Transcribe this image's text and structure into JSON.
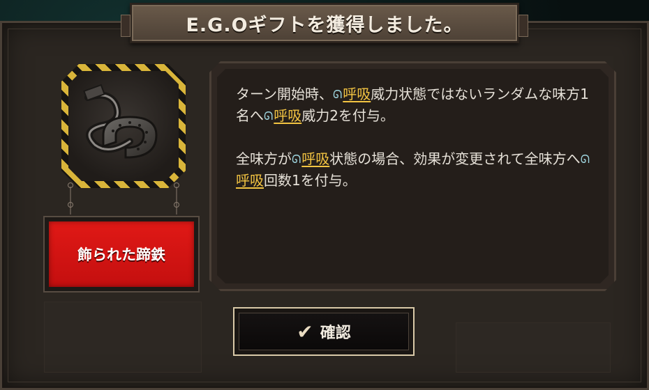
{
  "title": "E.G.Oギフトを獲得しました。",
  "gift": {
    "name": "飾られた蹄鉄",
    "emblem_icon": "decorated-horseshoe-icon"
  },
  "description": {
    "p1": {
      "t1": "ターン開始時、",
      "kw1": "呼吸",
      "t2": "威力状態ではないランダムな味方1名へ",
      "kw2": "呼吸",
      "t3": "威力2を付与。"
    },
    "p2": {
      "t1": "全味方が",
      "kw1": "呼吸",
      "t2": "状態の場合、効果が変更されて全味方へ",
      "kw2": "呼吸",
      "t3": "回数1を付与。"
    },
    "keyword_icon": "breath-icon",
    "keyword_color": "#f4c542"
  },
  "confirm": {
    "label": "確認",
    "icon": "checkmark-icon"
  },
  "colors": {
    "name_plate": "#e01916",
    "hazard_yellow": "#d9b53a",
    "frame": "#2b2621"
  }
}
